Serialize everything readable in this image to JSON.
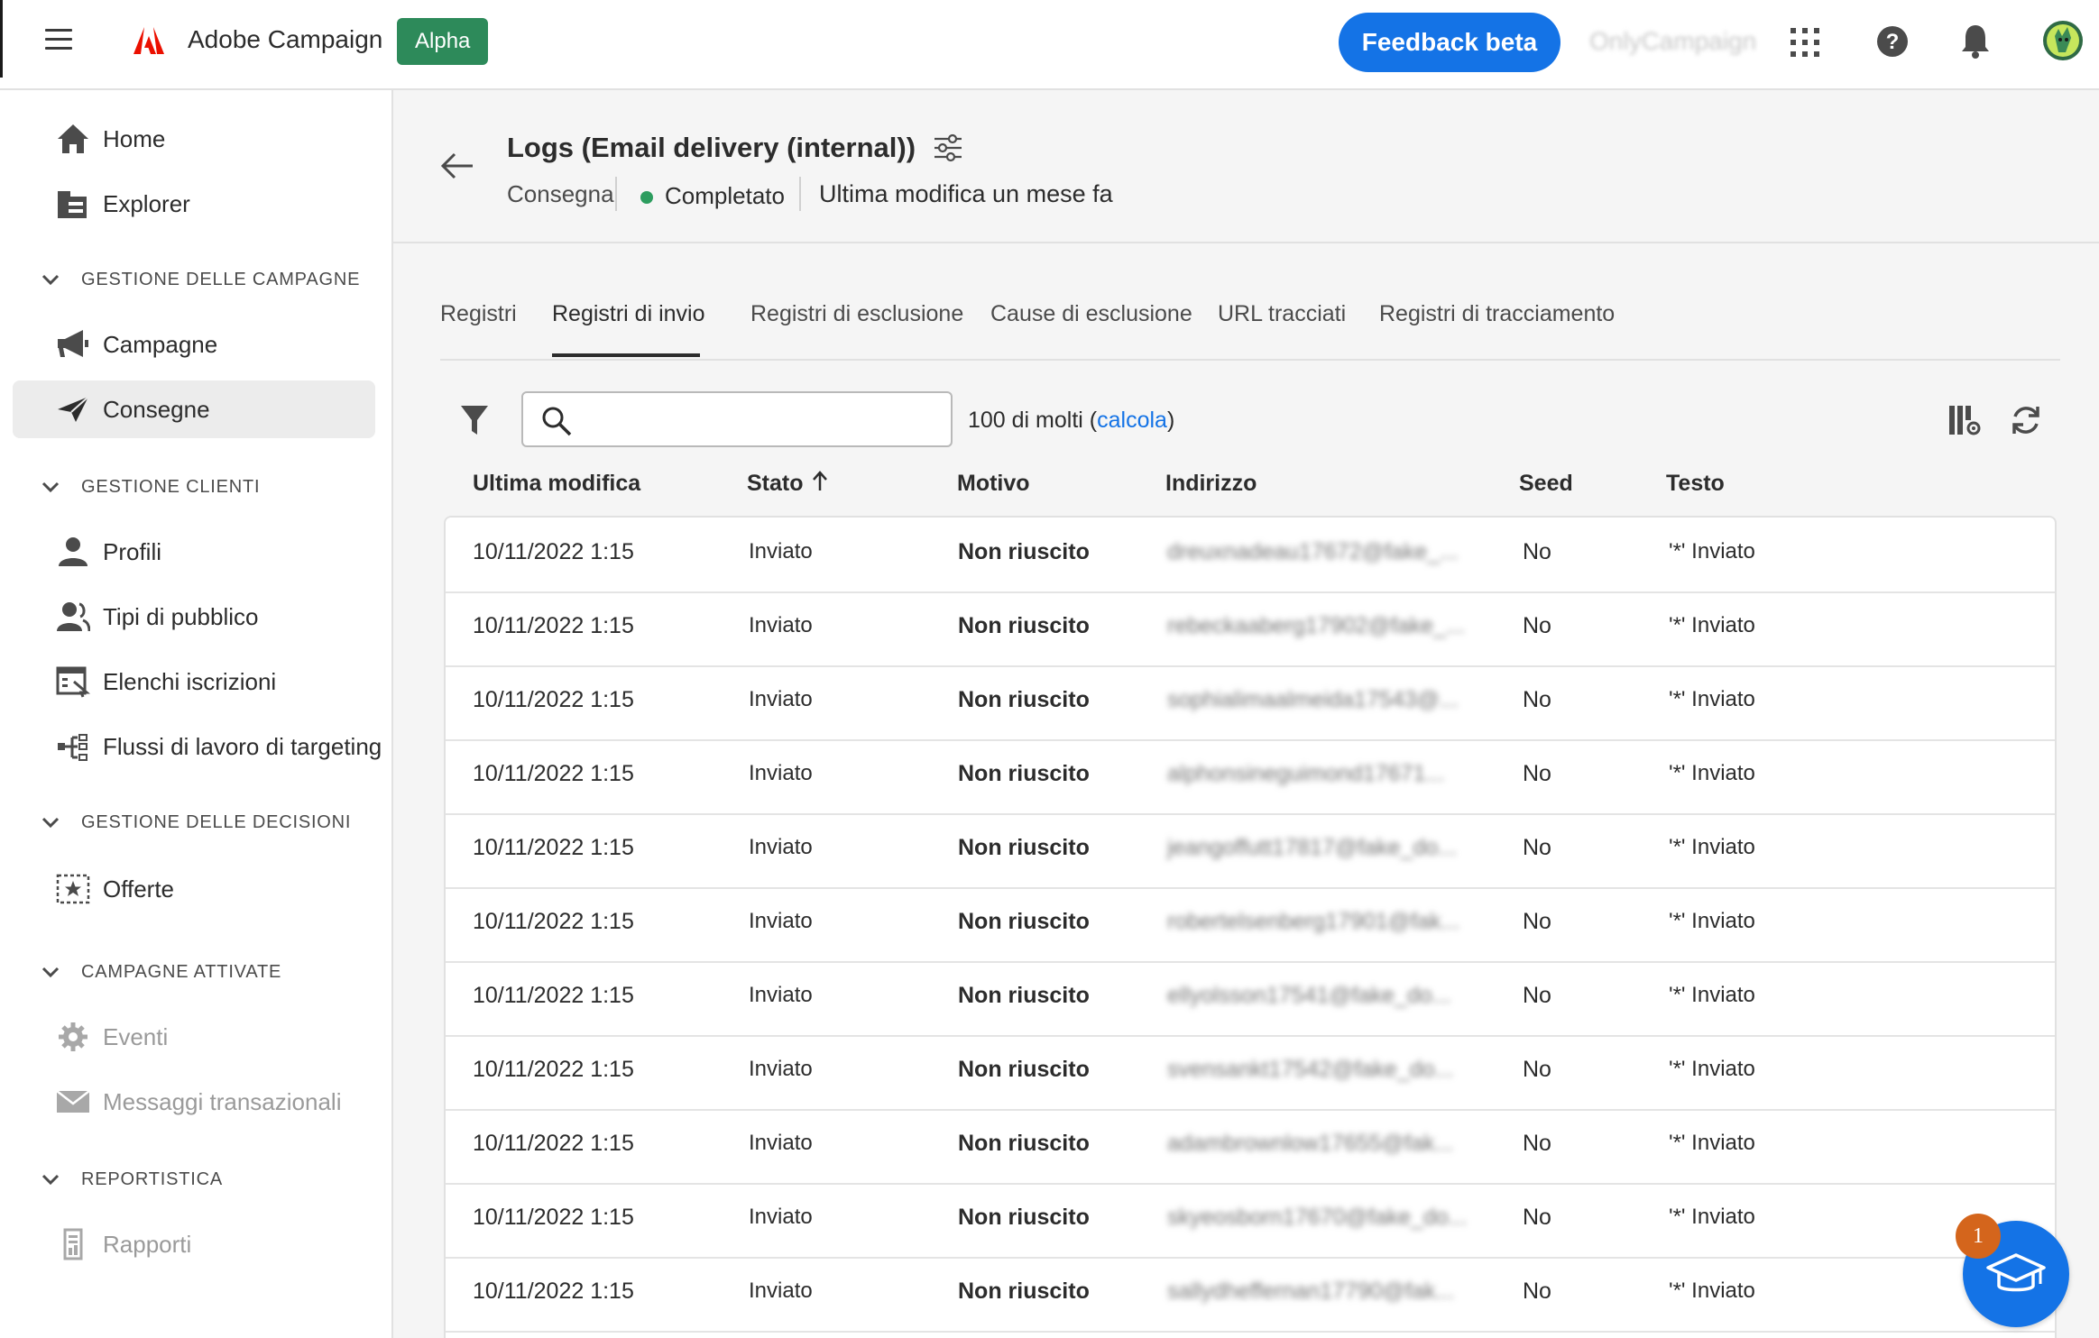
{
  "topbar": {
    "app_name": "Adobe Campaign",
    "env_badge": "Alpha",
    "feedback_label": "Feedback beta",
    "org_name": "OnlyCampaign"
  },
  "sidebar": {
    "items": [
      {
        "label": "Home",
        "icon": "home-icon"
      },
      {
        "label": "Explorer",
        "icon": "explorer-icon"
      },
      {
        "label": "Campagne",
        "icon": "megaphone-icon"
      },
      {
        "label": "Consegne",
        "icon": "send-icon",
        "active": true
      },
      {
        "label": "Profili",
        "icon": "user-icon"
      },
      {
        "label": "Tipi di pubblico",
        "icon": "audience-icon"
      },
      {
        "label": "Elenchi iscrizioni",
        "icon": "subscription-list-icon"
      },
      {
        "label": "Flussi di lavoro di targeting",
        "icon": "workflow-icon"
      },
      {
        "label": "Offerte",
        "icon": "offer-icon"
      },
      {
        "label": "Eventi",
        "icon": "gear-icon",
        "disabled": true
      },
      {
        "label": "Messaggi transazionali",
        "icon": "mail-icon",
        "disabled": true
      },
      {
        "label": "Rapporti",
        "icon": "report-icon",
        "disabled": true
      }
    ],
    "sections": [
      {
        "label": "GESTIONE DELLE CAMPAGNE"
      },
      {
        "label": "GESTIONE CLIENTI"
      },
      {
        "label": "GESTIONE DELLE DECISIONI"
      },
      {
        "label": "CAMPAGNE ATTIVATE"
      },
      {
        "label": "REPORTISTICA"
      }
    ]
  },
  "header": {
    "title": "Logs (Email delivery (internal))",
    "type": "Consegna",
    "status": "Completato",
    "modified": "Ultima modifica un mese fa"
  },
  "tabs": [
    {
      "label": "Registri"
    },
    {
      "label": "Registri di invio",
      "active": true
    },
    {
      "label": "Registri di esclusione"
    },
    {
      "label": "Cause di esclusione"
    },
    {
      "label": "URL tracciati"
    },
    {
      "label": "Registri di tracciamento"
    }
  ],
  "toolbar": {
    "search_placeholder": "",
    "count_prefix": "100 di molti (",
    "count_link": "calcola",
    "count_suffix": ")"
  },
  "table": {
    "columns": [
      "Ultima modifica",
      "Stato",
      "Motivo",
      "Indirizzo",
      "Seed",
      "Testo"
    ],
    "rows": [
      {
        "date": "10/11/2022 1:15",
        "stato": "Inviato",
        "motivo": "Non riuscito",
        "addr": "dreuxnadeau17672@fake_...",
        "seed": "No",
        "testo": "'*' Inviato"
      },
      {
        "date": "10/11/2022 1:15",
        "stato": "Inviato",
        "motivo": "Non riuscito",
        "addr": "rebeckaaberg17902@fake_...",
        "seed": "No",
        "testo": "'*' Inviato"
      },
      {
        "date": "10/11/2022 1:15",
        "stato": "Inviato",
        "motivo": "Non riuscito",
        "addr": "sophialimaalmeida17543@...",
        "seed": "No",
        "testo": "'*' Inviato"
      },
      {
        "date": "10/11/2022 1:15",
        "stato": "Inviato",
        "motivo": "Non riuscito",
        "addr": "alphonsineguimond17671...",
        "seed": "No",
        "testo": "'*' Inviato"
      },
      {
        "date": "10/11/2022 1:15",
        "stato": "Inviato",
        "motivo": "Non riuscito",
        "addr": "jeangoffutt17817@fake_do...",
        "seed": "No",
        "testo": "'*' Inviato"
      },
      {
        "date": "10/11/2022 1:15",
        "stato": "Inviato",
        "motivo": "Non riuscito",
        "addr": "robertelsenberg17901@fak...",
        "seed": "No",
        "testo": "'*' Inviato"
      },
      {
        "date": "10/11/2022 1:15",
        "stato": "Inviato",
        "motivo": "Non riuscito",
        "addr": "ellyolsson17541@fake_do...",
        "seed": "No",
        "testo": "'*' Inviato"
      },
      {
        "date": "10/11/2022 1:15",
        "stato": "Inviato",
        "motivo": "Non riuscito",
        "addr": "svensankt17542@fake_do...",
        "seed": "No",
        "testo": "'*' Inviato"
      },
      {
        "date": "10/11/2022 1:15",
        "stato": "Inviato",
        "motivo": "Non riuscito",
        "addr": "adambrownlow17655@fak...",
        "seed": "No",
        "testo": "'*' Inviato"
      },
      {
        "date": "10/11/2022 1:15",
        "stato": "Inviato",
        "motivo": "Non riuscito",
        "addr": "skyeosborn17670@fake_do...",
        "seed": "No",
        "testo": "'*' Inviato"
      },
      {
        "date": "10/11/2022 1:15",
        "stato": "Inviato",
        "motivo": "Non riuscito",
        "addr": "sallydheffernan17790@fak...",
        "seed": "No",
        "testo": "'*' Inviato"
      }
    ]
  },
  "help_fab": {
    "badge": "1"
  },
  "colors": {
    "accent": "#1473e6",
    "env_badge": "#2d8a5a",
    "status_complete": "#2d9d5f",
    "adobe_red": "#eb1000",
    "fab_badge": "#d4651c"
  }
}
